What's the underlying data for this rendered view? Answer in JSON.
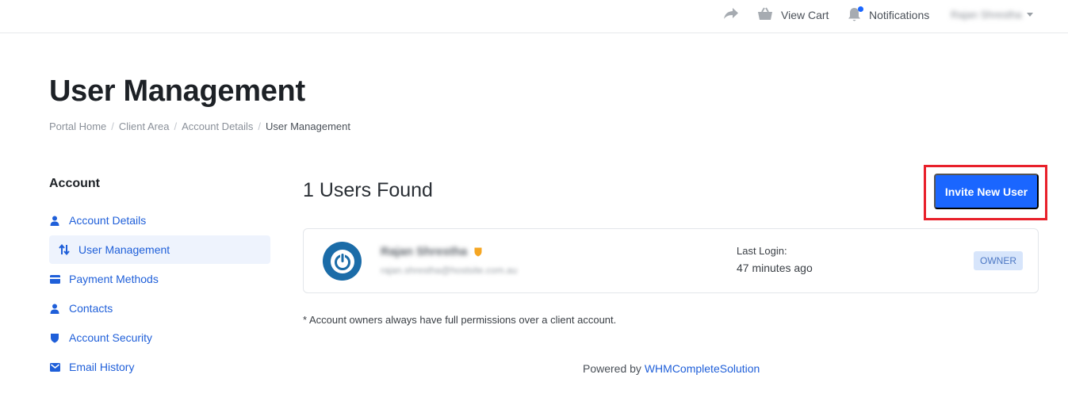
{
  "topbar": {
    "share_icon": "share-arrow-icon",
    "cart_label": "View Cart",
    "cart_icon": "basket-icon",
    "notifications_label": "Notifications",
    "bell_icon": "bell-icon",
    "user_name": "Rajan Shrestha"
  },
  "page": {
    "title": "User Management",
    "breadcrumb": [
      "Portal Home",
      "Client Area",
      "Account Details",
      "User Management"
    ]
  },
  "sidebar": {
    "heading": "Account",
    "items": [
      {
        "label": "Account Details",
        "icon": "user-icon"
      },
      {
        "label": "User Management",
        "icon": "sort-arrows-icon"
      },
      {
        "label": "Payment Methods",
        "icon": "credit-card-icon"
      },
      {
        "label": "Contacts",
        "icon": "user-icon"
      },
      {
        "label": "Account Security",
        "icon": "shield-icon"
      },
      {
        "label": "Email History",
        "icon": "envelope-icon"
      }
    ]
  },
  "main": {
    "users_found": "1 Users Found",
    "invite_label": "Invite New User",
    "user": {
      "name": "Rajan Shrestha",
      "email": "rajan.shrestha@hostsite.com.au",
      "last_login_label": "Last Login:",
      "last_login_value": "47 minutes ago",
      "role_badge": "OWNER"
    },
    "footnote": "* Account owners always have full permissions over a client account."
  },
  "footer": {
    "powered_by": "Powered by",
    "link": "WHMCompleteSolution"
  },
  "colors": {
    "accent": "#1a66ff",
    "link": "#1f5fd9",
    "highlight": "#e8202a",
    "badge_bg": "#d7e5fb"
  }
}
